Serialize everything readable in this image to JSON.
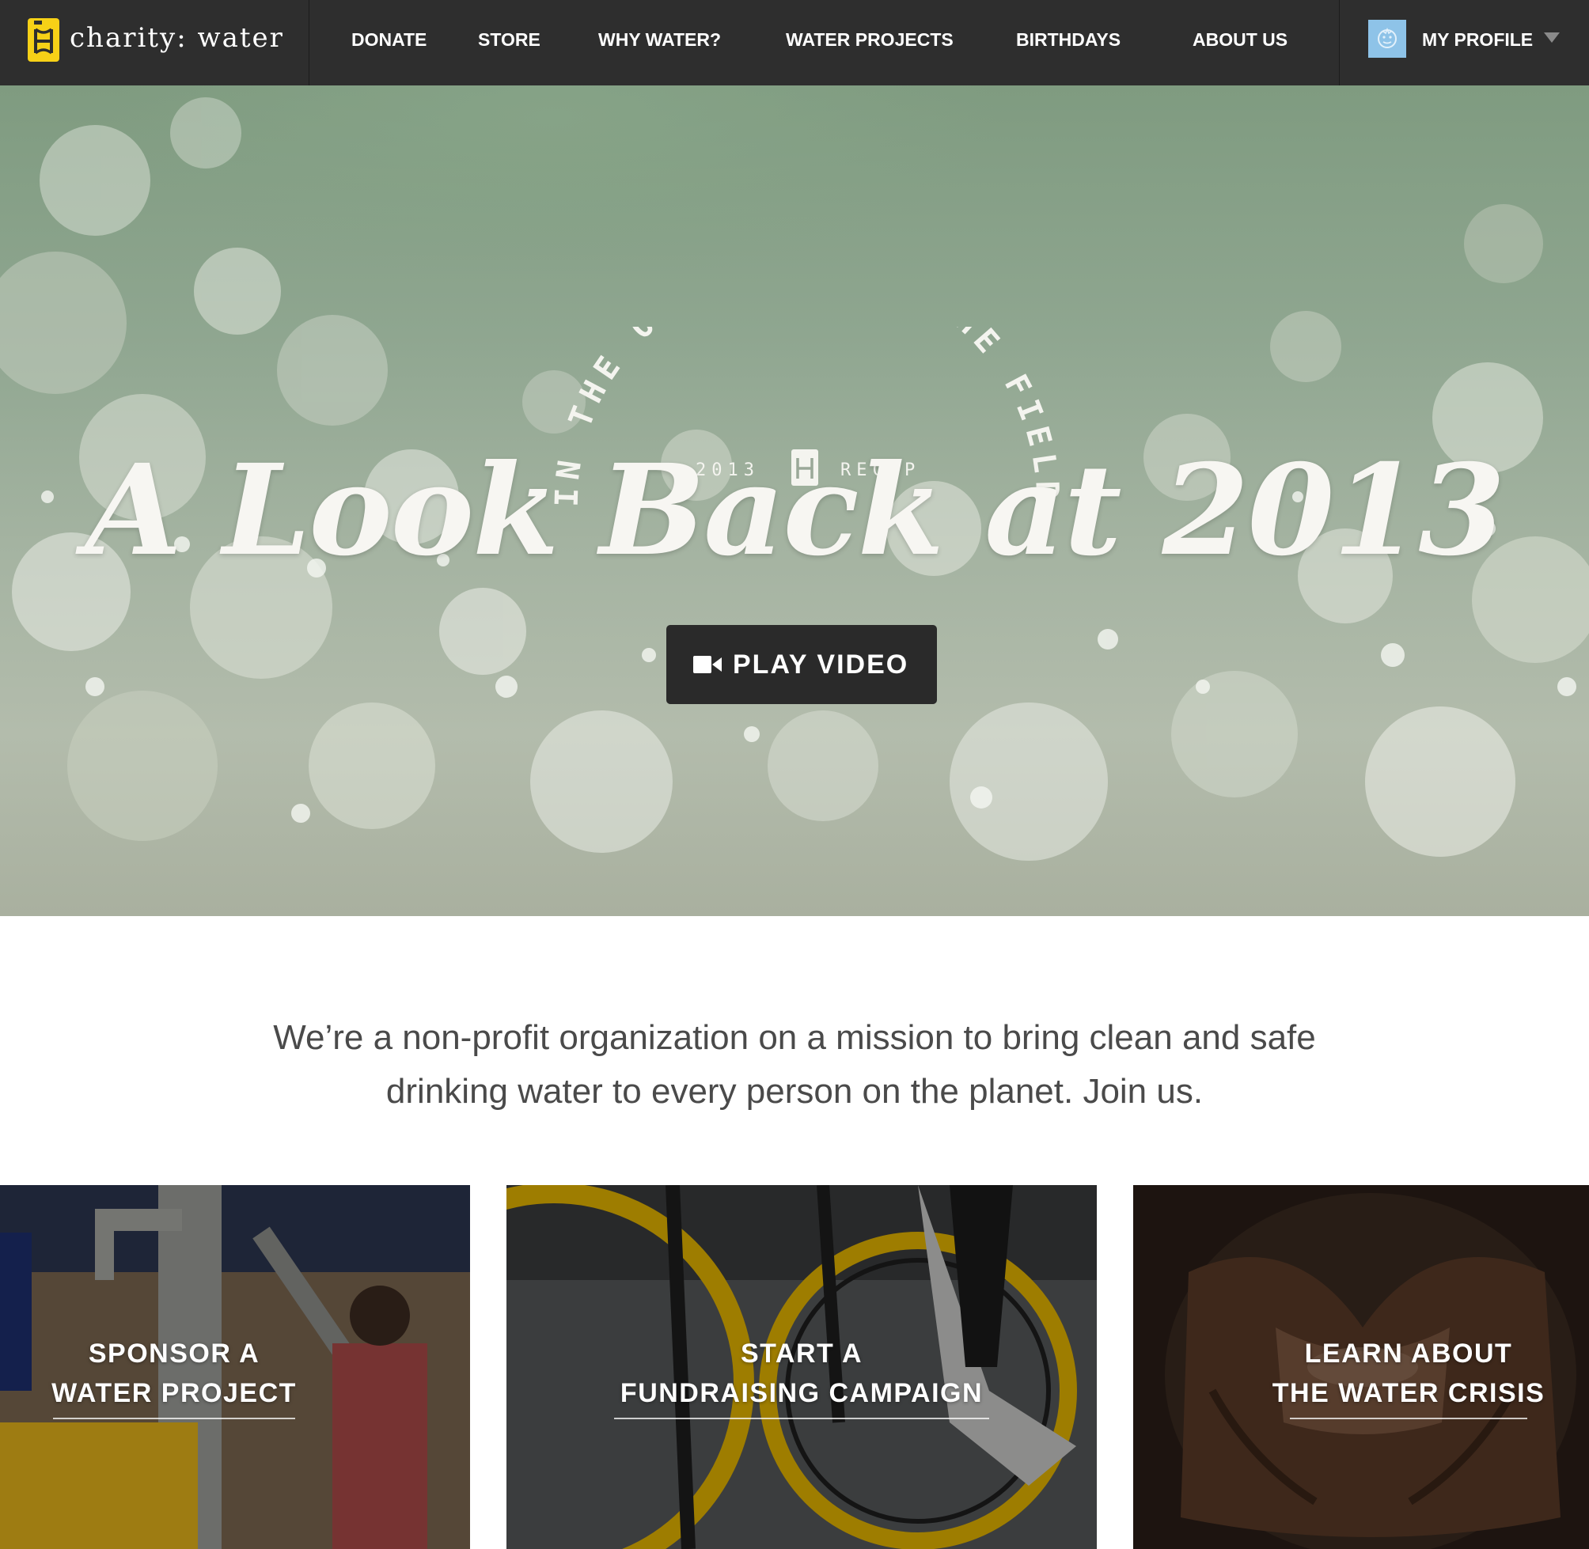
{
  "nav": {
    "brand": "charity: water",
    "items": [
      {
        "label": "DONATE"
      },
      {
        "label": "STORE"
      },
      {
        "label": "WHY WATER?"
      },
      {
        "label": "WATER PROJECTS"
      },
      {
        "label": "BIRTHDAYS"
      },
      {
        "label": "ABOUT US"
      }
    ],
    "profile_label": "MY PROFILE",
    "brand_color": "#f7d117",
    "bar_color": "#2e2e2e"
  },
  "hero": {
    "badge_arc": "IN THE OFFICE & IN THE FIELD",
    "badge_year": "2013",
    "badge_word": "RECAP",
    "title": "A Look Back at 2013",
    "play_label": "PLAY VIDEO",
    "play_icon": "video-camera-icon"
  },
  "mission": {
    "line1": "We’re a non-profit organization on a mission to bring clean and safe",
    "line2": "drinking water to every person on the planet. Join us."
  },
  "cards": [
    {
      "line1": "SPONSOR A",
      "line2": "WATER PROJECT"
    },
    {
      "line1": "START A",
      "line2": "FUNDRAISING CAMPAIGN"
    },
    {
      "line1": "LEARN ABOUT",
      "line2": "THE WATER CRISIS"
    }
  ]
}
